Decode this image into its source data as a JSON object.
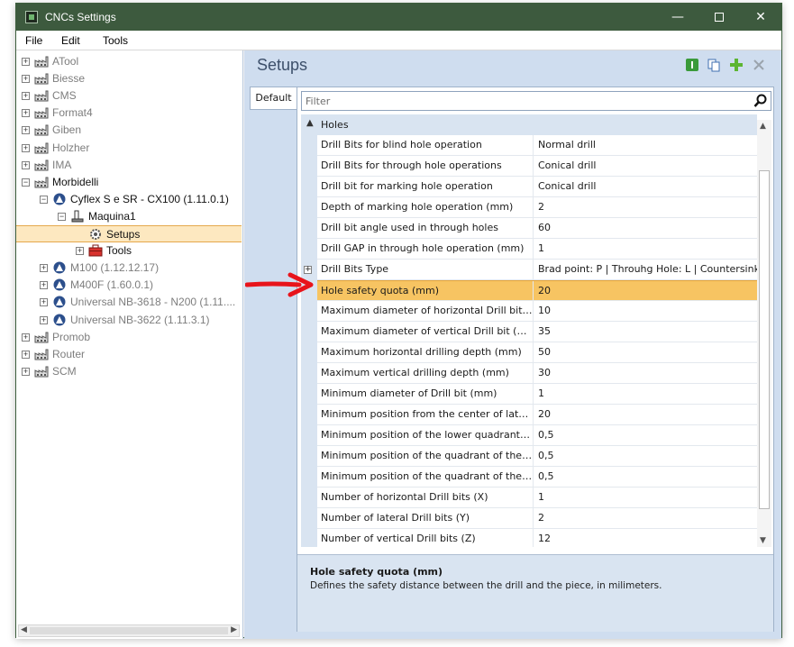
{
  "window": {
    "title": "CNCs Settings",
    "minimize": "—",
    "close": "✕"
  },
  "menu": [
    "File",
    "Edit",
    "Tools"
  ],
  "tree": {
    "items": [
      {
        "label": "ATool",
        "level": 0,
        "kind": "factory",
        "style": "gray"
      },
      {
        "label": "Biesse",
        "level": 0,
        "kind": "factory",
        "style": "gray"
      },
      {
        "label": "CMS",
        "level": 0,
        "kind": "factory",
        "style": "gray"
      },
      {
        "label": "Format4",
        "level": 0,
        "kind": "factory",
        "style": "gray"
      },
      {
        "label": "Giben",
        "level": 0,
        "kind": "factory",
        "style": "gray"
      },
      {
        "label": "Holzher",
        "level": 0,
        "kind": "factory",
        "style": "gray"
      },
      {
        "label": "IMA",
        "level": 0,
        "kind": "factory",
        "style": "gray"
      },
      {
        "label": "Morbidelli",
        "level": 0,
        "kind": "factory",
        "style": "black",
        "expanded": true
      },
      {
        "label": "Cyflex S e SR - CX100 (1.11.0.1)",
        "level": 1,
        "kind": "machine",
        "style": "black",
        "expanded": true
      },
      {
        "label": "Maquina1",
        "level": 2,
        "kind": "device",
        "style": "black",
        "expanded": true
      },
      {
        "label": "Setups",
        "level": 3,
        "kind": "gear",
        "style": "black",
        "selected": true
      },
      {
        "label": "Tools",
        "level": 3,
        "kind": "toolbox",
        "style": "black",
        "collapsed": true
      },
      {
        "label": "M100 (1.12.12.17)",
        "level": 1,
        "kind": "machine",
        "style": "gray"
      },
      {
        "label": "M400F (1.60.0.1)",
        "level": 1,
        "kind": "machine",
        "style": "gray"
      },
      {
        "label": "Universal NB-3618 - N200 (1.11....",
        "level": 1,
        "kind": "machine",
        "style": "gray"
      },
      {
        "label": "Universal NB-3622 (1.11.3.1)",
        "level": 1,
        "kind": "machine",
        "style": "gray"
      },
      {
        "label": "Promob",
        "level": 0,
        "kind": "factory",
        "style": "gray"
      },
      {
        "label": "Router",
        "level": 0,
        "kind": "factory",
        "style": "gray"
      },
      {
        "label": "SCM",
        "level": 0,
        "kind": "factory",
        "style": "gray"
      }
    ]
  },
  "panel": {
    "title": "Setups",
    "tab": "Default",
    "filter_placeholder": "Filter",
    "category": "Holes",
    "properties": [
      {
        "name": "Drill Bits for blind hole operation",
        "value": "Normal drill"
      },
      {
        "name": "Drill Bits for through hole operations",
        "value": "Conical drill"
      },
      {
        "name": "Drill bit for marking hole operation",
        "value": "Conical drill"
      },
      {
        "name": "Depth of marking hole operation (mm)",
        "value": "2"
      },
      {
        "name": "Drill bit angle used in through holes",
        "value": "60"
      },
      {
        "name": "Drill GAP in through hole operation (mm)",
        "value": "1"
      },
      {
        "name": "Drill Bits Type",
        "value": "Brad point: P  |  Throuhg Hole: L  |  Countersink: ",
        "expandable": true
      },
      {
        "name": "Hole safety quota (mm)",
        "value": "20",
        "selected": true
      },
      {
        "name": "Maximum diameter of horizontal Drill bit (mm)",
        "value": "10"
      },
      {
        "name": "Maximum diameter of vertical Drill bit (mm)",
        "value": "35"
      },
      {
        "name": "Maximum horizontal drilling depth (mm)",
        "value": "50"
      },
      {
        "name": "Maximum vertical drilling depth (mm)",
        "value": "30"
      },
      {
        "name": "Minimum diameter of Drill bit (mm)",
        "value": "1"
      },
      {
        "name": "Minimum position from the center of lateral h...",
        "value": "20"
      },
      {
        "name": "Minimum position of the lower quadrant of th...",
        "value": "0,5"
      },
      {
        "name": "Minimum position of the quadrant of the hori...",
        "value": "0,5"
      },
      {
        "name": "Minimum position of the quadrant of the late...",
        "value": "0,5"
      },
      {
        "name": "Number of horizontal Drill bits (X)",
        "value": "1"
      },
      {
        "name": "Number of lateral Drill bits (Y)",
        "value": "2"
      },
      {
        "name": "Number of vertical Drill bits (Z)",
        "value": "12"
      }
    ],
    "description": {
      "title": "Hole safety quota (mm)",
      "text": "Defines the safety distance between the drill and the piece, in milimeters."
    }
  },
  "colors": {
    "titlebar": "#3d5a3e",
    "selection": "#f7c462",
    "panel_bg": "#cfddef",
    "arrow": "#e8141b"
  }
}
